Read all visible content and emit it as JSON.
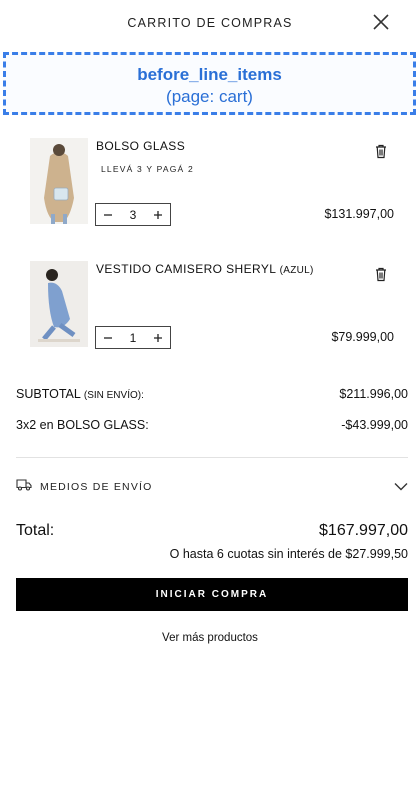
{
  "header": {
    "title": "CARRITO DE COMPRAS",
    "close_icon": "close-icon"
  },
  "placeholder": {
    "title": "before_line_items",
    "subtitle": "(page: cart)"
  },
  "items": [
    {
      "name": "BOLSO GLASS",
      "variant": "",
      "promo": "LLEVÁ 3 Y PAGÁ 2",
      "quantity": "3",
      "price": "$131.997,00"
    },
    {
      "name": "VESTIDO CAMISERO SHERYL",
      "variant": "(AZUL)",
      "promo": "",
      "quantity": "1",
      "price": "$79.999,00"
    }
  ],
  "summary": {
    "subtotal_label": "SUBTOTAL",
    "subtotal_note": "(SIN ENVÍO):",
    "subtotal_value": "$211.996,00",
    "discount_label": "3x2 en BOLSO GLASS:",
    "discount_value": "-$43.999,00"
  },
  "shipping": {
    "label": "MEDIOS DE ENVÍO",
    "icon": "truck-icon"
  },
  "total": {
    "label": "Total:",
    "value": "$167.997,00",
    "installments": "O hasta 6 cuotas sin interés de $27.999,50"
  },
  "cta": {
    "label": "INICIAR COMPRA"
  },
  "more_link": "Ver más productos",
  "colors": {
    "accent": "#2a6fd6",
    "button_bg": "#000000",
    "button_text": "#ffffff"
  }
}
